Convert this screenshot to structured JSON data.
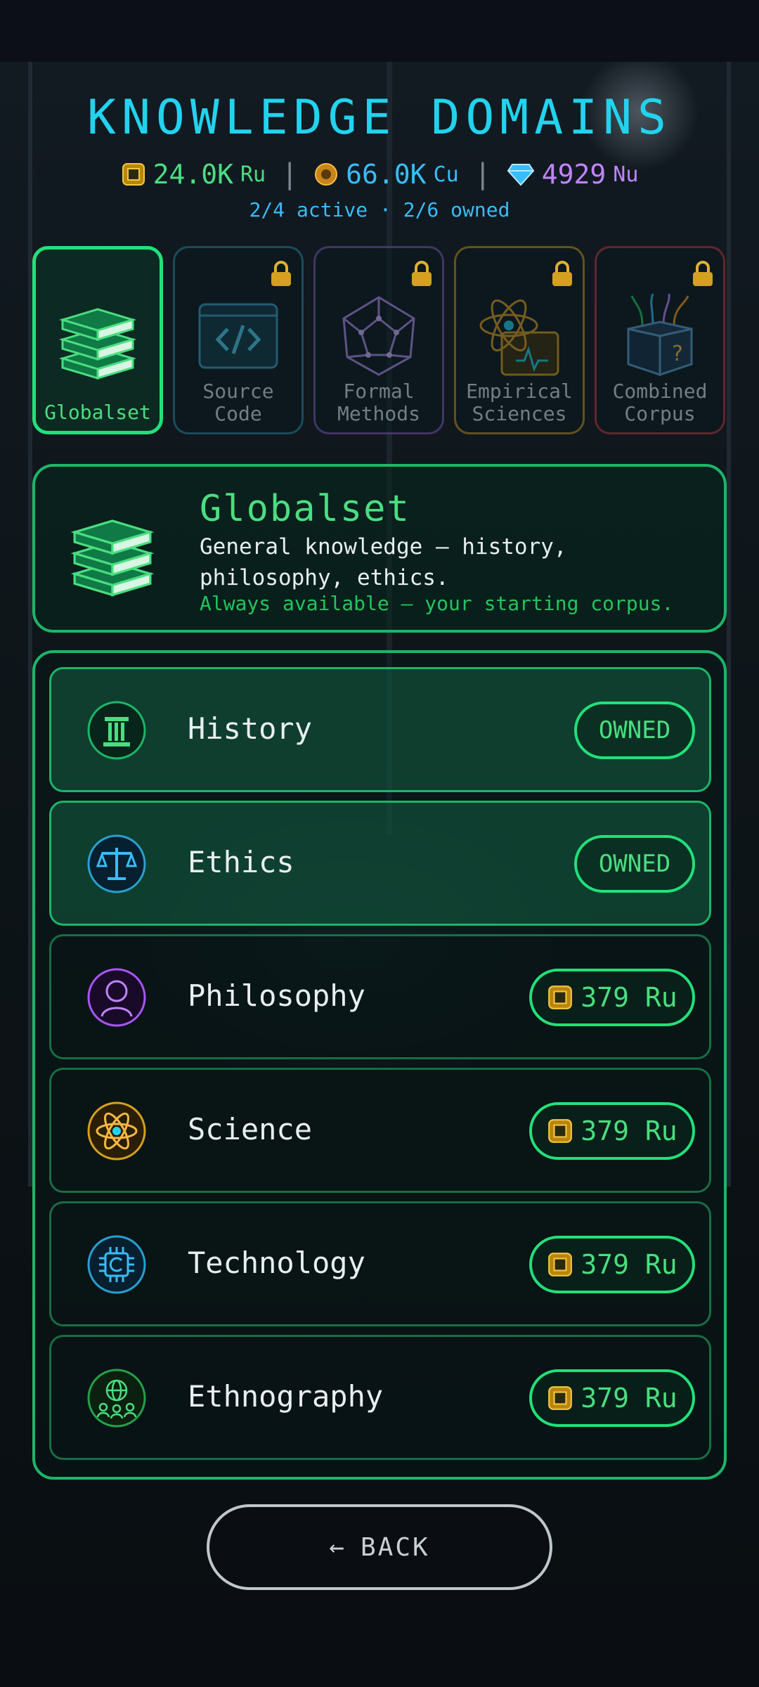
{
  "header": {
    "title": "KNOWLEDGE DOMAINS",
    "currencies": [
      {
        "amount": "24.0K",
        "unit": "Ru",
        "icon": "chip-coin-icon",
        "color": "#4ade80"
      },
      {
        "amount": "66.0K",
        "unit": "Cu",
        "icon": "copper-coin-icon",
        "color": "#38bdf8"
      },
      {
        "amount": "4929",
        "unit": "Nu",
        "icon": "diamond-icon",
        "color": "#c084fc"
      }
    ],
    "separator": "|",
    "status": "2/4 active · 2/6 owned"
  },
  "tabs": [
    {
      "label": "Globalset",
      "icon": "books-icon",
      "selected": true,
      "locked": false
    },
    {
      "label": "Source Code",
      "icon": "code-window-icon",
      "selected": false,
      "locked": true
    },
    {
      "label": "Formal Methods",
      "icon": "polyhedron-icon",
      "selected": false,
      "locked": true
    },
    {
      "label": "Empirical Sciences",
      "icon": "atom-icon",
      "selected": false,
      "locked": true
    },
    {
      "label": "Combined Corpus",
      "icon": "mystery-box-icon",
      "selected": false,
      "locked": true
    }
  ],
  "info": {
    "title": "Globalset",
    "description": "General knowledge — history, philosophy, ethics.",
    "note": "Always available — your starting corpus."
  },
  "subjects": [
    {
      "label": "History",
      "icon": "column-icon",
      "status": "OWNED",
      "owned": true
    },
    {
      "label": "Ethics",
      "icon": "scales-icon",
      "status": "OWNED",
      "owned": true
    },
    {
      "label": "Philosophy",
      "icon": "thinker-head-icon",
      "price": "379 Ru",
      "owned": false
    },
    {
      "label": "Science",
      "icon": "atom-icon",
      "price": "379 Ru",
      "owned": false
    },
    {
      "label": "Technology",
      "icon": "chip-icon",
      "price": "379 Ru",
      "owned": false
    },
    {
      "label": "Ethnography",
      "icon": "globe-people-icon",
      "price": "379 Ru",
      "owned": false
    }
  ],
  "back_button": {
    "arrow": "←",
    "label": "BACK"
  }
}
